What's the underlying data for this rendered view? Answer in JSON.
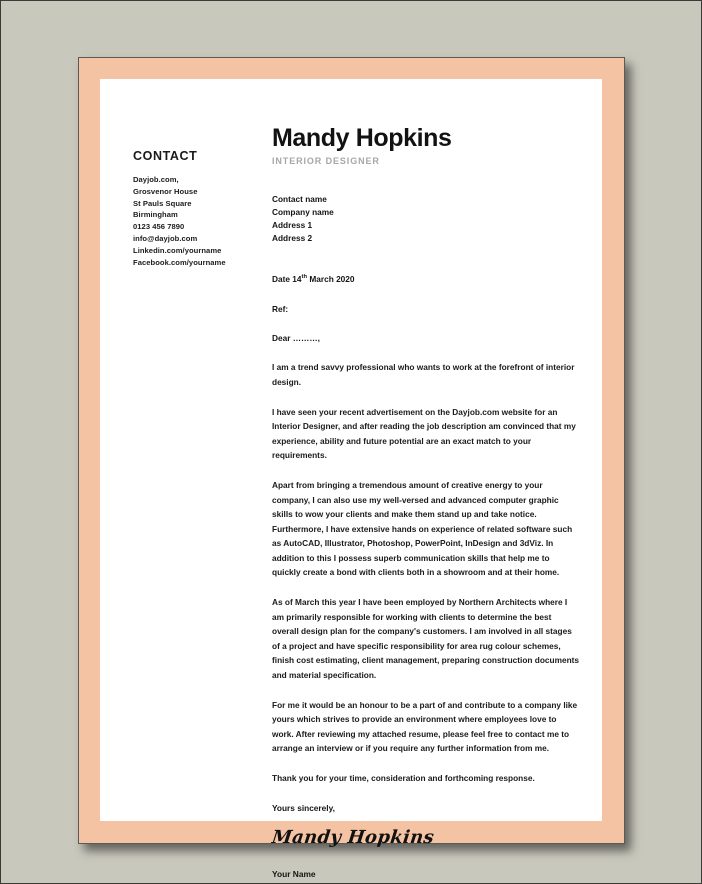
{
  "theme": {
    "background": "#c9c8bd",
    "border_frame": "#f4c3a3",
    "page": "#ffffff",
    "text": "#1b1b1b",
    "muted_text": "#a7a7a7"
  },
  "contact": {
    "heading": "CONTACT",
    "lines": [
      "Dayjob.com,",
      "Grosvenor House",
      "St Pauls Square",
      "Birmingham",
      "0123 456 7890",
      "info@dayjob.com",
      "Linkedin.com/yourname",
      "Facebook.com/yourname"
    ]
  },
  "header": {
    "name": "Mandy Hopkins",
    "role": "INTERIOR DESIGNER"
  },
  "recipient": {
    "lines": [
      "Contact name",
      "Company name",
      "Address 1",
      "Address 2"
    ]
  },
  "letter": {
    "date_prefix": "Date 14",
    "date_ordinal": "th",
    "date_suffix": " March 2020",
    "ref": "Ref:",
    "salutation": "Dear ………,",
    "paragraphs": [
      "I am a trend savvy professional who wants to work at the forefront of interior design.",
      "I have seen your recent advertisement on the Dayjob.com website for an Interior Designer, and after reading the job description am convinced that my experience, ability and future potential are an exact match to your requirements.",
      "Apart from bringing a tremendous amount of creative energy to your company, I can also use my well-versed and advanced computer graphic skills to wow your clients and make them stand up and take notice. Furthermore, I have extensive hands on experience of related software such as AutoCAD, Illustrator, Photoshop, PowerPoint, InDesign and 3dViz. In addition to this I possess superb communication skills that help me to quickly create a bond with clients both in a showroom and at their home.",
      "As of March this year I have been employed by Northern Architects where I am primarily responsible for working with clients to determine the best overall design plan for the company's customers. I am involved in all stages of a project and have specific responsibility for area rug colour schemes, finish cost estimating, client management, preparing construction documents and material specification.",
      "For me it would be an honour to be a part of and contribute to a company like yours which strives to provide an environment where employees love to work. After reviewing my attached resume, please feel free to contact me to arrange an interview or if you require any further information from me.",
      "Thank you for your time, consideration and forthcoming response."
    ],
    "closing": "Yours sincerely,",
    "signature_script": "Mandy Hopkins",
    "signature_name": "Your Name"
  }
}
